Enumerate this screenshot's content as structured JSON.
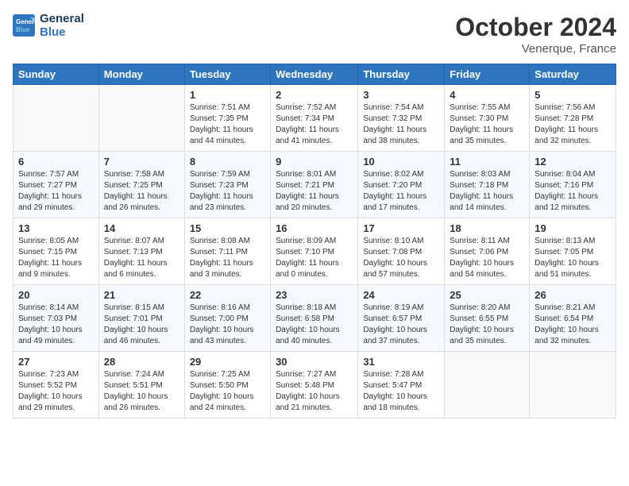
{
  "header": {
    "logo_line1": "General",
    "logo_line2": "Blue",
    "month": "October 2024",
    "location": "Venerque, France"
  },
  "weekdays": [
    "Sunday",
    "Monday",
    "Tuesday",
    "Wednesday",
    "Thursday",
    "Friday",
    "Saturday"
  ],
  "weeks": [
    [
      {
        "day": "",
        "sunrise": "",
        "sunset": "",
        "daylight": ""
      },
      {
        "day": "",
        "sunrise": "",
        "sunset": "",
        "daylight": ""
      },
      {
        "day": "1",
        "sunrise": "Sunrise: 7:51 AM",
        "sunset": "Sunset: 7:35 PM",
        "daylight": "Daylight: 11 hours and 44 minutes."
      },
      {
        "day": "2",
        "sunrise": "Sunrise: 7:52 AM",
        "sunset": "Sunset: 7:34 PM",
        "daylight": "Daylight: 11 hours and 41 minutes."
      },
      {
        "day": "3",
        "sunrise": "Sunrise: 7:54 AM",
        "sunset": "Sunset: 7:32 PM",
        "daylight": "Daylight: 11 hours and 38 minutes."
      },
      {
        "day": "4",
        "sunrise": "Sunrise: 7:55 AM",
        "sunset": "Sunset: 7:30 PM",
        "daylight": "Daylight: 11 hours and 35 minutes."
      },
      {
        "day": "5",
        "sunrise": "Sunrise: 7:56 AM",
        "sunset": "Sunset: 7:28 PM",
        "daylight": "Daylight: 11 hours and 32 minutes."
      }
    ],
    [
      {
        "day": "6",
        "sunrise": "Sunrise: 7:57 AM",
        "sunset": "Sunset: 7:27 PM",
        "daylight": "Daylight: 11 hours and 29 minutes."
      },
      {
        "day": "7",
        "sunrise": "Sunrise: 7:58 AM",
        "sunset": "Sunset: 7:25 PM",
        "daylight": "Daylight: 11 hours and 26 minutes."
      },
      {
        "day": "8",
        "sunrise": "Sunrise: 7:59 AM",
        "sunset": "Sunset: 7:23 PM",
        "daylight": "Daylight: 11 hours and 23 minutes."
      },
      {
        "day": "9",
        "sunrise": "Sunrise: 8:01 AM",
        "sunset": "Sunset: 7:21 PM",
        "daylight": "Daylight: 11 hours and 20 minutes."
      },
      {
        "day": "10",
        "sunrise": "Sunrise: 8:02 AM",
        "sunset": "Sunset: 7:20 PM",
        "daylight": "Daylight: 11 hours and 17 minutes."
      },
      {
        "day": "11",
        "sunrise": "Sunrise: 8:03 AM",
        "sunset": "Sunset: 7:18 PM",
        "daylight": "Daylight: 11 hours and 14 minutes."
      },
      {
        "day": "12",
        "sunrise": "Sunrise: 8:04 AM",
        "sunset": "Sunset: 7:16 PM",
        "daylight": "Daylight: 11 hours and 12 minutes."
      }
    ],
    [
      {
        "day": "13",
        "sunrise": "Sunrise: 8:05 AM",
        "sunset": "Sunset: 7:15 PM",
        "daylight": "Daylight: 11 hours and 9 minutes."
      },
      {
        "day": "14",
        "sunrise": "Sunrise: 8:07 AM",
        "sunset": "Sunset: 7:13 PM",
        "daylight": "Daylight: 11 hours and 6 minutes."
      },
      {
        "day": "15",
        "sunrise": "Sunrise: 8:08 AM",
        "sunset": "Sunset: 7:11 PM",
        "daylight": "Daylight: 11 hours and 3 minutes."
      },
      {
        "day": "16",
        "sunrise": "Sunrise: 8:09 AM",
        "sunset": "Sunset: 7:10 PM",
        "daylight": "Daylight: 11 hours and 0 minutes."
      },
      {
        "day": "17",
        "sunrise": "Sunrise: 8:10 AM",
        "sunset": "Sunset: 7:08 PM",
        "daylight": "Daylight: 10 hours and 57 minutes."
      },
      {
        "day": "18",
        "sunrise": "Sunrise: 8:11 AM",
        "sunset": "Sunset: 7:06 PM",
        "daylight": "Daylight: 10 hours and 54 minutes."
      },
      {
        "day": "19",
        "sunrise": "Sunrise: 8:13 AM",
        "sunset": "Sunset: 7:05 PM",
        "daylight": "Daylight: 10 hours and 51 minutes."
      }
    ],
    [
      {
        "day": "20",
        "sunrise": "Sunrise: 8:14 AM",
        "sunset": "Sunset: 7:03 PM",
        "daylight": "Daylight: 10 hours and 49 minutes."
      },
      {
        "day": "21",
        "sunrise": "Sunrise: 8:15 AM",
        "sunset": "Sunset: 7:01 PM",
        "daylight": "Daylight: 10 hours and 46 minutes."
      },
      {
        "day": "22",
        "sunrise": "Sunrise: 8:16 AM",
        "sunset": "Sunset: 7:00 PM",
        "daylight": "Daylight: 10 hours and 43 minutes."
      },
      {
        "day": "23",
        "sunrise": "Sunrise: 8:18 AM",
        "sunset": "Sunset: 6:58 PM",
        "daylight": "Daylight: 10 hours and 40 minutes."
      },
      {
        "day": "24",
        "sunrise": "Sunrise: 8:19 AM",
        "sunset": "Sunset: 6:57 PM",
        "daylight": "Daylight: 10 hours and 37 minutes."
      },
      {
        "day": "25",
        "sunrise": "Sunrise: 8:20 AM",
        "sunset": "Sunset: 6:55 PM",
        "daylight": "Daylight: 10 hours and 35 minutes."
      },
      {
        "day": "26",
        "sunrise": "Sunrise: 8:21 AM",
        "sunset": "Sunset: 6:54 PM",
        "daylight": "Daylight: 10 hours and 32 minutes."
      }
    ],
    [
      {
        "day": "27",
        "sunrise": "Sunrise: 7:23 AM",
        "sunset": "Sunset: 5:52 PM",
        "daylight": "Daylight: 10 hours and 29 minutes."
      },
      {
        "day": "28",
        "sunrise": "Sunrise: 7:24 AM",
        "sunset": "Sunset: 5:51 PM",
        "daylight": "Daylight: 10 hours and 26 minutes."
      },
      {
        "day": "29",
        "sunrise": "Sunrise: 7:25 AM",
        "sunset": "Sunset: 5:50 PM",
        "daylight": "Daylight: 10 hours and 24 minutes."
      },
      {
        "day": "30",
        "sunrise": "Sunrise: 7:27 AM",
        "sunset": "Sunset: 5:48 PM",
        "daylight": "Daylight: 10 hours and 21 minutes."
      },
      {
        "day": "31",
        "sunrise": "Sunrise: 7:28 AM",
        "sunset": "Sunset: 5:47 PM",
        "daylight": "Daylight: 10 hours and 18 minutes."
      },
      {
        "day": "",
        "sunrise": "",
        "sunset": "",
        "daylight": ""
      },
      {
        "day": "",
        "sunrise": "",
        "sunset": "",
        "daylight": ""
      }
    ]
  ]
}
